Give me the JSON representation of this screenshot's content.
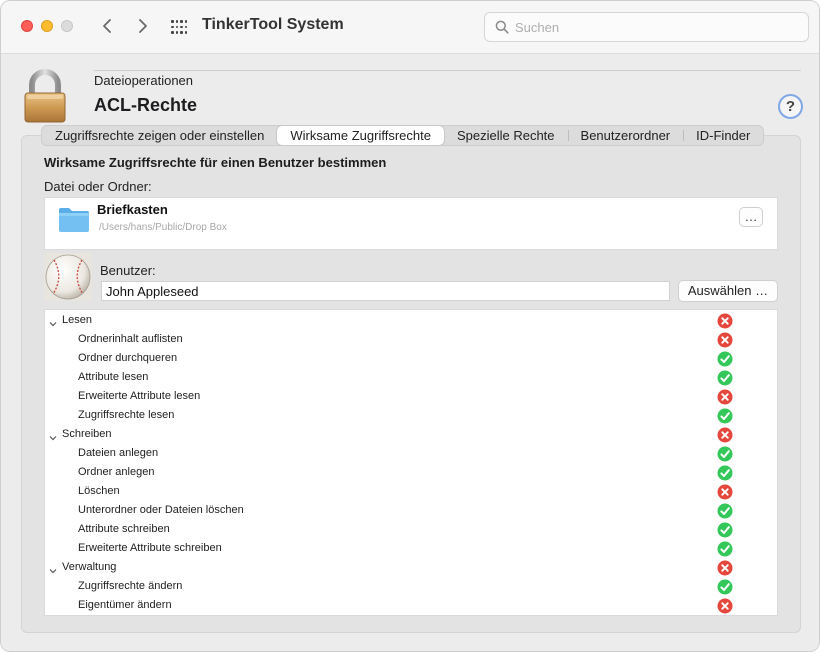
{
  "window": {
    "app_title": "TinkerTool System",
    "search_placeholder": "Suchen"
  },
  "header": {
    "subtitle": "Dateioperationen",
    "title": "ACL-Rechte",
    "help_label": "?"
  },
  "tabs": [
    {
      "label": "Zugriffsrechte zeigen oder einstellen",
      "active": false
    },
    {
      "label": "Wirksame Zugriffsrechte",
      "active": true
    },
    {
      "label": "Spezielle Rechte",
      "active": false
    },
    {
      "label": "Benutzerordner",
      "active": false
    },
    {
      "label": "ID-Finder",
      "active": false
    }
  ],
  "panel": {
    "heading": "Wirksame Zugriffsrechte für einen Benutzer bestimmen",
    "file_label": "Datei oder Ordner:",
    "file_name": "Briefkasten",
    "file_path": "/Users/hans/Public/Drop Box",
    "choose_file_label": "…",
    "user_label": "Benutzer:",
    "user_value": "John Appleseed",
    "select_user_label": "Auswählen …"
  },
  "permissions": [
    {
      "label": "Lesen",
      "group": true,
      "allowed": false
    },
    {
      "label": "Ordnerinhalt auflisten",
      "group": false,
      "allowed": false
    },
    {
      "label": "Ordner durchqueren",
      "group": false,
      "allowed": true
    },
    {
      "label": "Attribute lesen",
      "group": false,
      "allowed": true
    },
    {
      "label": "Erweiterte Attribute lesen",
      "group": false,
      "allowed": false
    },
    {
      "label": "Zugriffsrechte lesen",
      "group": false,
      "allowed": true
    },
    {
      "label": "Schreiben",
      "group": true,
      "allowed": false
    },
    {
      "label": "Dateien anlegen",
      "group": false,
      "allowed": true
    },
    {
      "label": "Ordner anlegen",
      "group": false,
      "allowed": true
    },
    {
      "label": "Löschen",
      "group": false,
      "allowed": false
    },
    {
      "label": "Unterordner oder Dateien löschen",
      "group": false,
      "allowed": true
    },
    {
      "label": "Attribute schreiben",
      "group": false,
      "allowed": true
    },
    {
      "label": "Erweiterte Attribute schreiben",
      "group": false,
      "allowed": true
    },
    {
      "label": "Verwaltung",
      "group": true,
      "allowed": false
    },
    {
      "label": "Zugriffsrechte ändern",
      "group": false,
      "allowed": true
    },
    {
      "label": "Eigentümer ändern",
      "group": false,
      "allowed": false
    }
  ],
  "colors": {
    "allowed": "#34c759",
    "denied": "#e5473d",
    "accent": "#7fa7e6"
  },
  "icons": {
    "lock": "lock-icon",
    "folder": "folder-icon",
    "user": "baseball-user-icon"
  }
}
